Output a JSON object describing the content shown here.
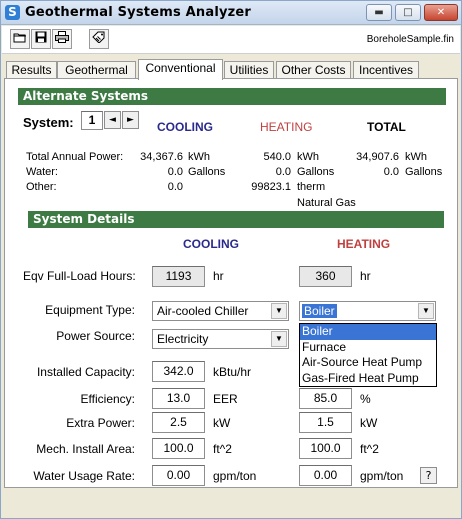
{
  "window": {
    "title": "Geothermal Systems Analyzer",
    "app_icon_glyph": "S",
    "minimize_glyph": "▬",
    "maximize_glyph": "□",
    "close_glyph": "✕"
  },
  "toolbar": {
    "filename": "BoreholeSample.fin",
    "icons": [
      "open-folder-icon",
      "save-disk-icon",
      "printer-icon",
      "tag-icon"
    ]
  },
  "tabs": [
    {
      "label": "Results"
    },
    {
      "label": "Geothermal"
    },
    {
      "label": "Conventional",
      "active": true
    },
    {
      "label": "Utilities"
    },
    {
      "label": "Other Costs"
    },
    {
      "label": "Incentives"
    }
  ],
  "alternate_systems": {
    "header": "Alternate Systems",
    "system_label": "System:",
    "system_value": "1",
    "prev_glyph": "◄",
    "next_glyph": "►",
    "col_cooling": "COOLING",
    "col_heating": "HEATING",
    "col_total": "TOTAL",
    "rows": [
      {
        "label": "Total Annual Power:",
        "cooling": "34,367.6",
        "cooling_unit": "kWh",
        "heating": "540.0",
        "heating_unit": "kWh",
        "total": "34,907.6",
        "total_unit": "kWh"
      },
      {
        "label": "Water:",
        "cooling": "0.0",
        "cooling_unit": "Gallons",
        "heating": "0.0",
        "heating_unit": "Gallons",
        "total": "0.0",
        "total_unit": "Gallons"
      },
      {
        "label": "Other:",
        "cooling": "0.0",
        "cooling_unit": "",
        "heating": "99823.1",
        "heating_unit": "therm",
        "total": "",
        "total_unit": ""
      }
    ],
    "other_fuel": "Natural Gas"
  },
  "system_details": {
    "header": "System Details",
    "col_cooling": "COOLING",
    "col_heating": "HEATING",
    "eqv_label": "Eqv Full-Load Hours:",
    "eqv_cooling": "1193",
    "eqv_heating": "360",
    "eqv_unit": "hr",
    "equipment_label": "Equipment Type:",
    "equipment_cooling": "Air-cooled Chiller",
    "equipment_heating": "Boiler",
    "power_label": "Power Source:",
    "power_cooling": "Electricity",
    "heating_options": [
      "Boiler",
      "Furnace",
      "Air-Source Heat Pump",
      "Gas-Fired Heat Pump"
    ],
    "installed_label": "Installed Capacity:",
    "installed_cooling": "342.0",
    "installed_unit": "kBtu/hr",
    "efficiency_label": "Efficiency:",
    "efficiency_cooling": "13.0",
    "efficiency_cooling_unit": "EER",
    "efficiency_heating": "85.0",
    "efficiency_heating_unit": "%",
    "extra_label": "Extra Power:",
    "extra_cooling": "2.5",
    "extra_heating": "1.5",
    "extra_unit": "kW",
    "mech_label": "Mech. Install Area:",
    "mech_cooling": "100.0",
    "mech_heating": "100.0",
    "mech_unit": "ft^2",
    "water_label": "Water Usage Rate:",
    "water_cooling": "0.00",
    "water_heating": "0.00",
    "water_unit": "gpm/ton",
    "help_glyph": "?"
  },
  "colors": {
    "section_header": "#3d7a44",
    "cooling": "#2a2a8c",
    "heating": "#c04040",
    "selection": "#3a74d4"
  }
}
